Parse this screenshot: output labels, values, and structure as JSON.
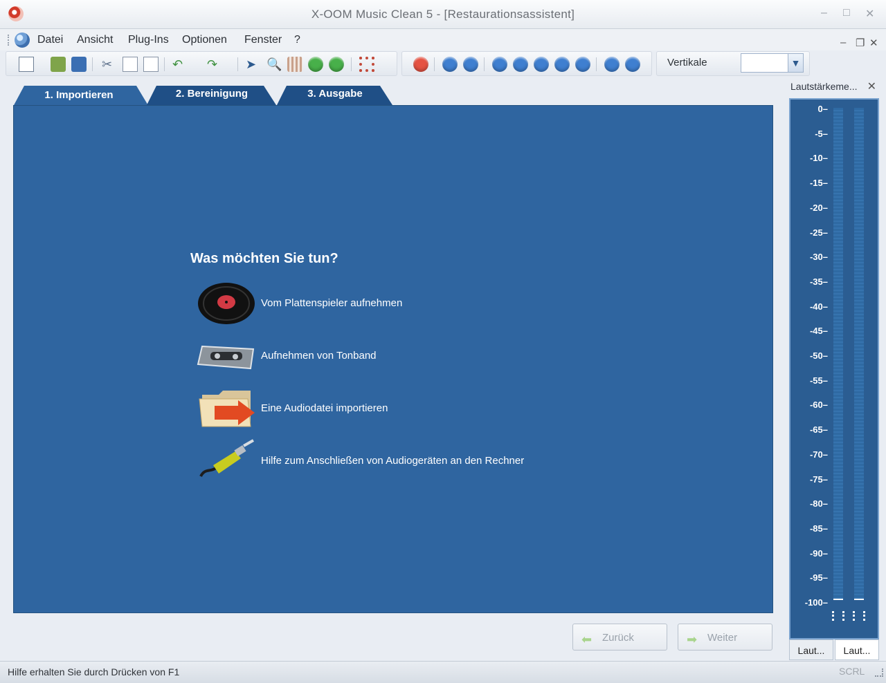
{
  "window": {
    "title": "X-OOM Music Clean 5 - [Restaurationsassistent]"
  },
  "menubar": {
    "items": [
      "Datei",
      "Ansicht",
      "Plug-Ins",
      "Optionen",
      "Fenster",
      "?"
    ]
  },
  "toolbar": {
    "vertikale_label": "Vertikale",
    "vertikale_value": ""
  },
  "wizard": {
    "tabs": [
      "1. Importieren",
      "2. Bereinigung",
      "3. Ausgabe"
    ],
    "question": "Was möchten Sie tun?",
    "options": [
      {
        "label": "Vom Plattenspieler aufnehmen",
        "icon": "vinyl-record-icon"
      },
      {
        "label": "Aufnehmen von Tonband",
        "icon": "cassette-tape-icon"
      },
      {
        "label": "Eine Audiodatei importieren",
        "icon": "folder-import-icon"
      },
      {
        "label": "Hilfe zum Anschließen von Audiogeräten an den Rechner",
        "icon": "audio-cable-icon"
      }
    ],
    "back_button": "Zurück",
    "next_button": "Weiter"
  },
  "meter": {
    "title": "Lautstärkeme...",
    "ticks": [
      "0–",
      "-5–",
      "-10–",
      "-15–",
      "-20–",
      "-25–",
      "-30–",
      "-35–",
      "-40–",
      "-45–",
      "-50–",
      "-55–",
      "-60–",
      "-65–",
      "-70–",
      "-75–",
      "-80–",
      "-85–",
      "-90–",
      "-95–",
      "-100–"
    ],
    "tabs": [
      "Laut...",
      "Laut..."
    ]
  },
  "status": {
    "text": "Hilfe erhalten Sie durch Drücken von F1",
    "scrl": "SCRL"
  },
  "colors": {
    "panel": "#2f65a0",
    "accent": "#1f4f86"
  }
}
